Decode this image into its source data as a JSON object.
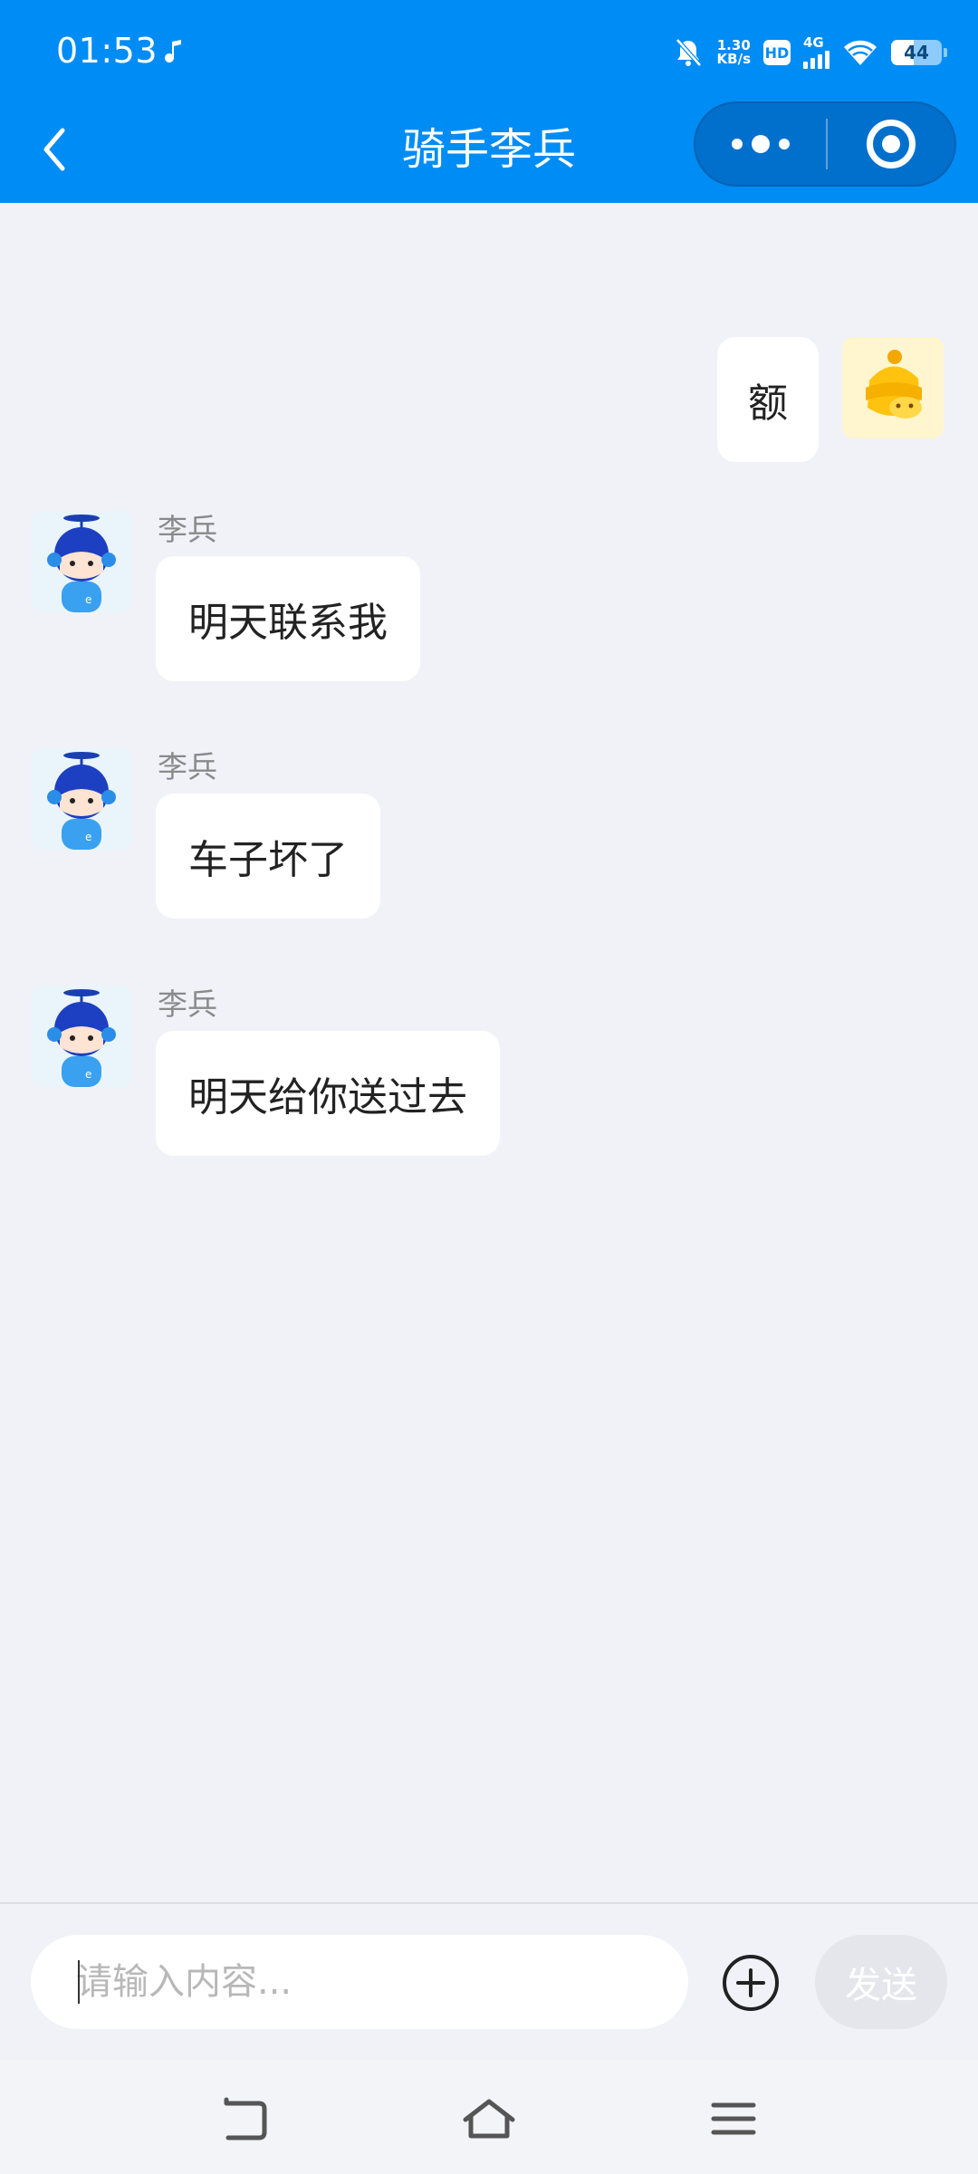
{
  "status_bar": {
    "time": "01:53",
    "net_speed_value": "1.30",
    "net_speed_unit": "KB/s",
    "hd": "HD",
    "network": "4G",
    "battery": "44"
  },
  "title_bar": {
    "title": "骑手李兵"
  },
  "messages": [
    {
      "side": "right",
      "text": "额"
    },
    {
      "side": "left",
      "sender": "李兵",
      "text": "明天联系我"
    },
    {
      "side": "left",
      "sender": "李兵",
      "text": "车子坏了"
    },
    {
      "side": "left",
      "sender": "李兵",
      "text": "明天给你送过去"
    }
  ],
  "input_bar": {
    "placeholder": "请输入内容...",
    "value": "",
    "send_label": "发送"
  },
  "colors": {
    "header_bg": "#008cf5",
    "chat_bg": "#f0f2f7",
    "bubble_bg": "#ffffff",
    "send_disabled_bg": "#e4e6eb"
  },
  "icons": {
    "back": "chevron-left-icon",
    "more": "more-dots-icon",
    "close_miniprogram": "target-circle-icon",
    "plus": "plus-circle-icon",
    "nav_back": "nav-back-icon",
    "nav_home": "nav-home-icon",
    "nav_menu": "nav-menu-icon"
  }
}
